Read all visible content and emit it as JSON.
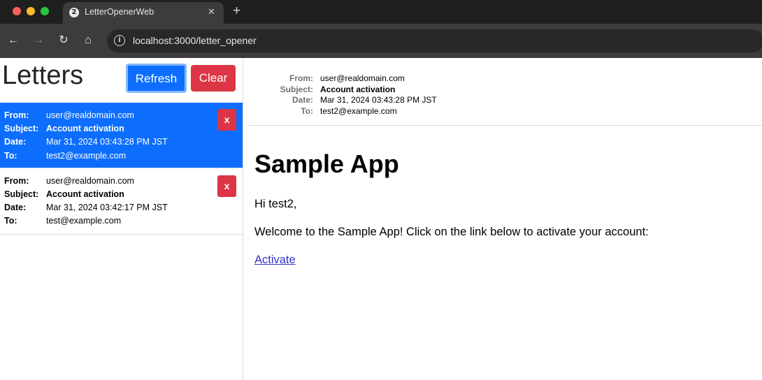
{
  "browser": {
    "tab_title": "LetterOpenerWeb",
    "tab_favicon": "2",
    "url": "localhost:3000/letter_opener"
  },
  "sidebar": {
    "title": "Letters",
    "refresh_label": "Refresh",
    "clear_label": "Clear",
    "labels": {
      "from": "From:",
      "subject": "Subject:",
      "date": "Date:",
      "to": "To:"
    },
    "delete_label": "x",
    "letters": [
      {
        "from": "user@realdomain.com",
        "subject": "Account activation",
        "date": "Mar 31, 2024 03:43:28 PM JST",
        "to": "test2@example.com"
      },
      {
        "from": "user@realdomain.com",
        "subject": "Account activation",
        "date": "Mar 31, 2024 03:42:17 PM JST",
        "to": "test@example.com"
      }
    ]
  },
  "preview": {
    "labels": {
      "from": "From:",
      "subject": "Subject:",
      "date": "Date:",
      "to": "To:"
    },
    "from": "user@realdomain.com",
    "subject": "Account activation",
    "date": "Mar 31, 2024 03:43:28 PM JST",
    "to": "test2@example.com",
    "heading": "Sample App",
    "greeting": "Hi test2,",
    "message": "Welcome to the Sample App! Click on the link below to activate your account:",
    "link": "Activate"
  },
  "colors": {
    "primary": "#0d6efd",
    "danger": "#dc3545",
    "link": "#3333cc"
  }
}
